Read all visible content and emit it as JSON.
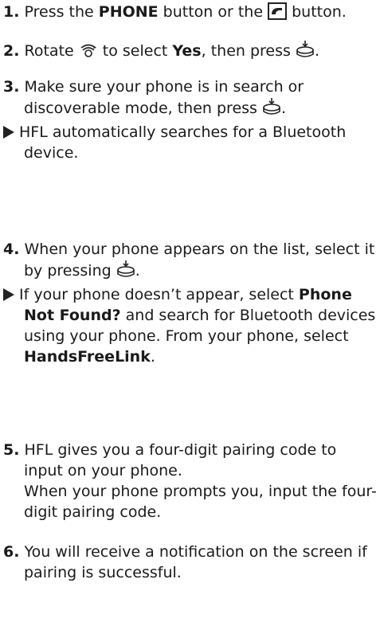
{
  "steps": [
    {
      "num": "1.",
      "parts": [
        "Press the ",
        "PHONE",
        " button or the ",
        " button."
      ]
    },
    {
      "num": "2.",
      "parts": [
        "Rotate ",
        " to select ",
        "Yes",
        ", then press ",
        "."
      ]
    },
    {
      "num": "3.",
      "parts": [
        "Make sure your phone is in search or discoverable mode, then press ",
        "."
      ],
      "sub": [
        "HFL automatically searches for a Bluetooth device."
      ]
    },
    {
      "num": "4.",
      "parts": [
        "When your phone appears on the list, select it by pressing ",
        "."
      ],
      "sub": [
        "If your phone doesn’t appear, select ",
        "Phone Not Found?",
        " and search for Bluetooth devices using your phone. From your phone, select ",
        "HandsFreeLink",
        "."
      ]
    },
    {
      "num": "5.",
      "parts": [
        "HFL gives you a four-digit pairing code to input on your phone."
      ],
      "extra": "When your phone prompts you, input the four-digit pairing code."
    },
    {
      "num": "6.",
      "parts": [
        "You will receive a notification on the screen if pairing is successful."
      ]
    }
  ],
  "icons": {
    "phone": "phone-button-icon",
    "rotate": "selector-knob-rotate-icon",
    "press": "selector-knob-press-icon",
    "bullet": "result-arrow-icon"
  }
}
